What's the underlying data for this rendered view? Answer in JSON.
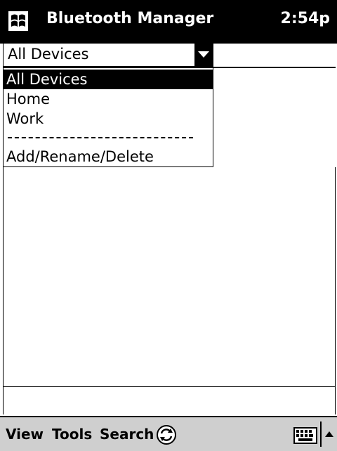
{
  "titlebar": {
    "title": "Bluetooth Manager",
    "time": "2:54p",
    "start_icon": "windows-flag-icon"
  },
  "filter": {
    "value": "All Devices",
    "arrow_icon": "chevron-down-icon"
  },
  "dropdown": {
    "items": [
      {
        "label": "All Devices",
        "selected": true
      },
      {
        "label": "Home",
        "selected": false
      },
      {
        "label": "Work",
        "selected": false
      }
    ],
    "separator": "-----------------------------------",
    "manage_label": "Add/Rename/Delete"
  },
  "menubar": {
    "view": "View",
    "tools": "Tools",
    "search": "Search",
    "sync_icon": "sync-icon",
    "keyboard_icon": "keyboard-icon",
    "sip_arrow_icon": "arrow-up-icon"
  }
}
